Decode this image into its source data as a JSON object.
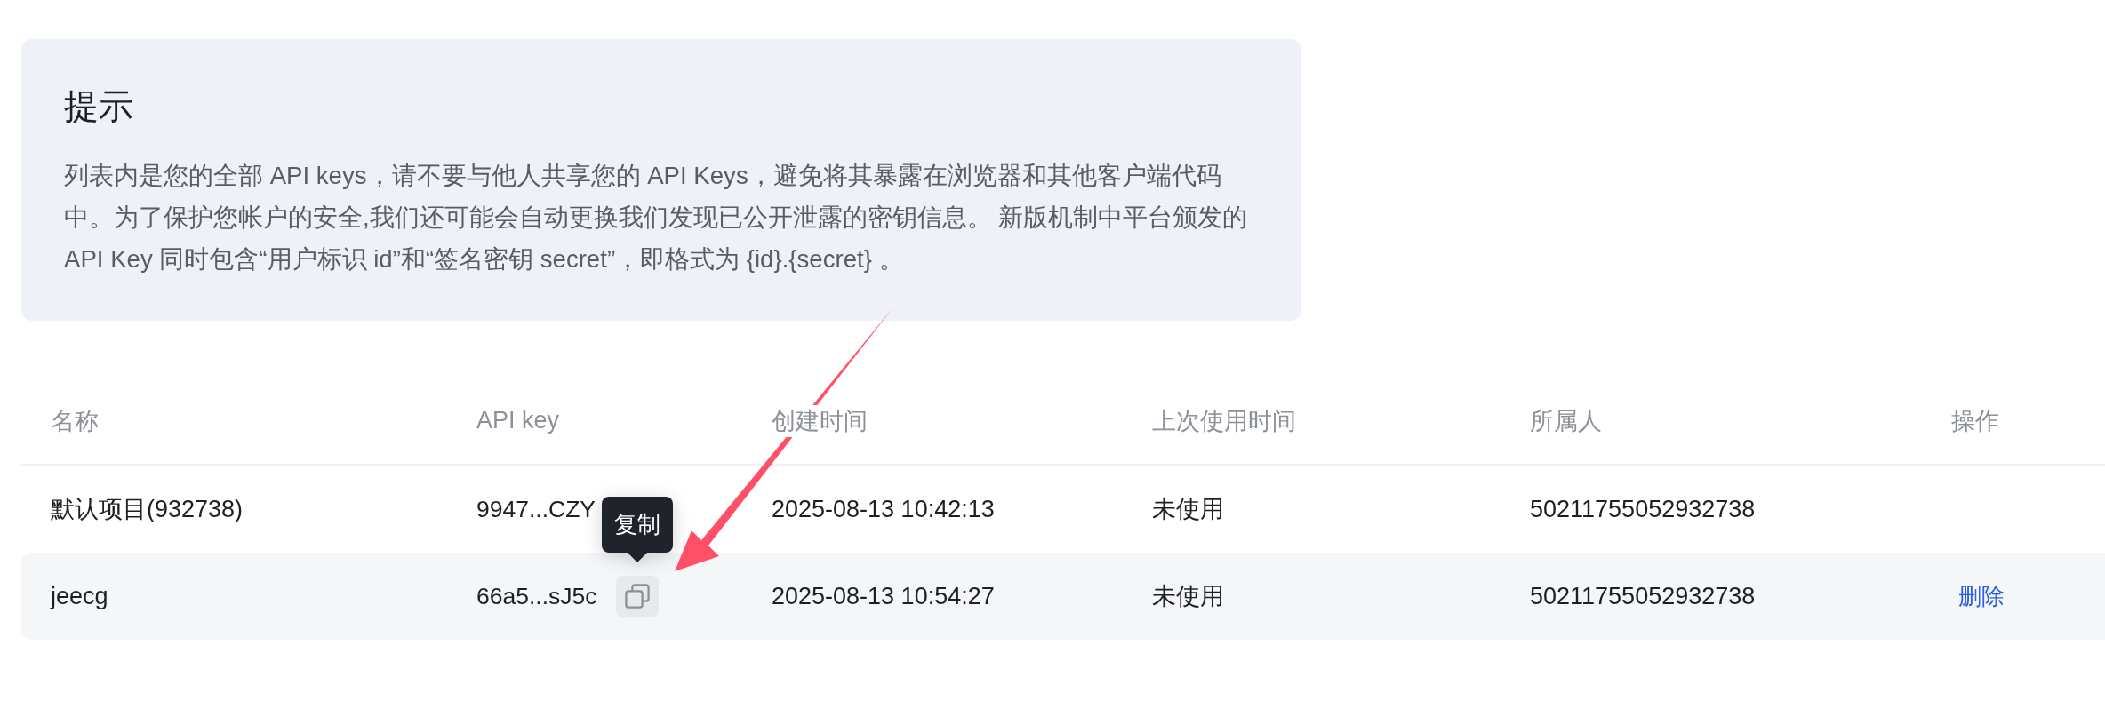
{
  "notice": {
    "title": "提示",
    "body": "列表内是您的全部 API keys，请不要与他人共享您的 API Keys，避免将其暴露在浏览器和其他客户端代码中。为了保护您帐户的安全,我们还可能会自动更换我们发现已公开泄露的密钥信息。 新版机制中平台颁发的 API Key 同时包含“用户标识 id”和“签名密钥 secret”，即格式为 {id}.{secret} 。"
  },
  "table": {
    "columns": [
      "名称",
      "API key",
      "创建时间",
      "上次使用时间",
      "所属人",
      "操作"
    ],
    "rows": [
      {
        "name": "默认项目(932738)",
        "api_key": "9947...CZY",
        "created": "2025-08-13 10:42:13",
        "last_used": "未使用",
        "owner": "50211755052932738",
        "hovered": false
      },
      {
        "name": "jeecg",
        "api_key": "66a5...sJ5c",
        "created": "2025-08-13 10:54:27",
        "last_used": "未使用",
        "owner": "50211755052932738",
        "hovered": true,
        "copy_tooltip": "复制",
        "actions": [
          "删除"
        ]
      }
    ]
  }
}
